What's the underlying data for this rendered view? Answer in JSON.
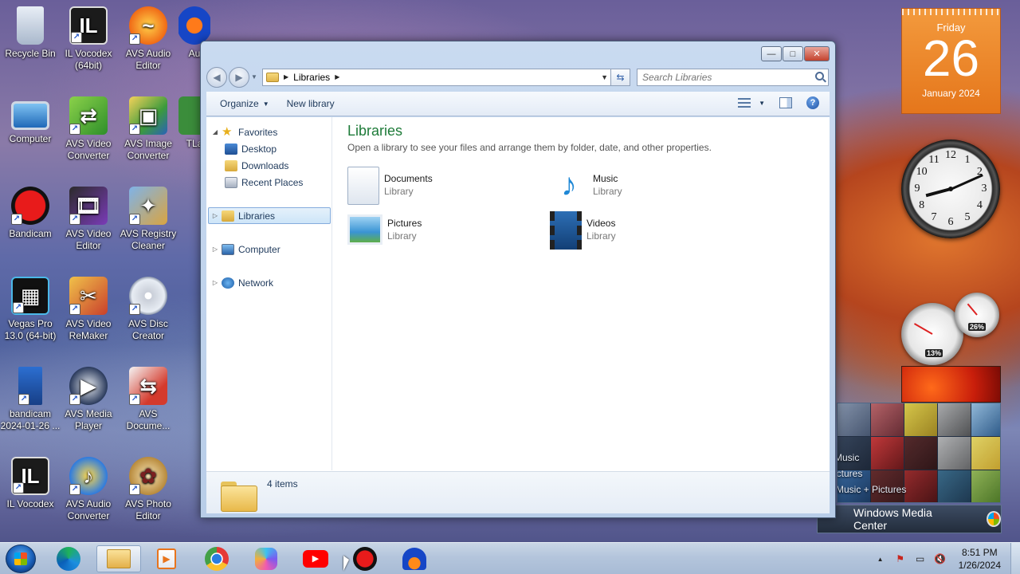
{
  "desktop": {
    "icons": [
      {
        "label": "Recycle Bin",
        "icon": "recycle-bin-icon"
      },
      {
        "label": "IL Vocodex (64bit)",
        "icon": "il-vocodex-icon"
      },
      {
        "label": "AVS Audio Editor",
        "icon": "avs-audio-editor-icon"
      },
      {
        "label": "Au",
        "icon": "audacity-icon"
      },
      {
        "label": "Computer",
        "icon": "computer-icon"
      },
      {
        "label": "AVS Video Converter",
        "icon": "avs-video-converter-icon"
      },
      {
        "label": "AVS Image Converter",
        "icon": "avs-image-converter-icon"
      },
      {
        "label": "TLa",
        "icon": "tla-icon"
      },
      {
        "label": "Bandicam",
        "icon": "bandicam-icon"
      },
      {
        "label": "AVS Video Editor",
        "icon": "avs-video-editor-icon"
      },
      {
        "label": "AVS Registry Cleaner",
        "icon": "avs-registry-cleaner-icon"
      },
      {
        "label": "Vegas Pro 13.0 (64-bit)",
        "icon": "vegas-pro-icon"
      },
      {
        "label": "AVS Video ReMaker",
        "icon": "avs-video-remaker-icon"
      },
      {
        "label": "AVS Disc Creator",
        "icon": "avs-disc-creator-icon"
      },
      {
        "label": "bandicam 2024-01-26 ...",
        "icon": "video-file-icon"
      },
      {
        "label": "AVS Media Player",
        "icon": "avs-media-player-icon"
      },
      {
        "label": "AVS Docume...",
        "icon": "avs-document-converter-icon"
      },
      {
        "label": "IL Vocodex",
        "icon": "il-vocodex-icon"
      },
      {
        "label": "AVS Audio Converter",
        "icon": "avs-audio-converter-icon"
      },
      {
        "label": "AVS Photo Editor",
        "icon": "avs-photo-editor-icon"
      }
    ]
  },
  "window": {
    "controls": {
      "minimize": "—",
      "maximize": "□",
      "close": "✕"
    },
    "address": {
      "crumb": "Libraries"
    },
    "search": {
      "placeholder": "Search Libraries"
    },
    "toolbar": {
      "organize": "Organize",
      "new_library": "New library",
      "help": "?"
    },
    "nav": {
      "favorites": "Favorites",
      "desktop": "Desktop",
      "downloads": "Downloads",
      "recent": "Recent Places",
      "libraries": "Libraries",
      "computer": "Computer",
      "network": "Network"
    },
    "main": {
      "title": "Libraries",
      "subtitle": "Open a library to see your files and arrange them by folder, date, and other properties.",
      "libraries": [
        {
          "name": "Documents",
          "kind": "Library",
          "icon": "documents-library-icon"
        },
        {
          "name": "Music",
          "kind": "Library",
          "icon": "music-library-icon"
        },
        {
          "name": "Pictures",
          "kind": "Library",
          "icon": "pictures-library-icon"
        },
        {
          "name": "Videos",
          "kind": "Library",
          "icon": "videos-library-icon"
        }
      ]
    },
    "details": {
      "count": "4 items"
    }
  },
  "gadgets": {
    "calendar": {
      "day": "Friday",
      "date": "26",
      "month": "January 2024"
    },
    "clock_numbers": [
      "12",
      "1",
      "2",
      "3",
      "4",
      "5",
      "6",
      "7",
      "8",
      "9",
      "10",
      "11"
    ],
    "cpu_meter": {
      "cpu": "13%",
      "ram": "26%"
    },
    "media_center": {
      "menu": [
        "Music",
        "ictures",
        "Music + Pictures"
      ],
      "title": "Windows Media Center"
    }
  },
  "taskbar": {
    "apps": [
      "edge-icon",
      "file-explorer-icon",
      "media-player-icon",
      "chrome-icon",
      "copilot-icon",
      "youtube-icon",
      "bandicam-icon",
      "audacity-icon"
    ],
    "time": "8:51 PM",
    "date": "1/26/2024",
    "tray_expand": "▲"
  },
  "colors": {
    "accent_title": "#1e7b39",
    "calendar": "#e5761b"
  }
}
